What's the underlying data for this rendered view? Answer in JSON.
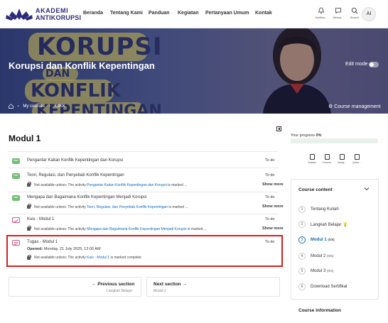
{
  "nav": {
    "logo_line1": "AKADEMI",
    "logo_line2": "ANTIKORUPSI",
    "links": [
      "Beranda",
      "Tentang Kami",
      "Panduan",
      "Kegiatan",
      "Pertanyaan Umum",
      "Kontak"
    ],
    "notifications": "Notifica...",
    "messages": "Messa...",
    "search": "Search",
    "avatar": "AI"
  },
  "hero": {
    "bg_word1": "KORUPSI",
    "bg_word2": "DAN",
    "bg_word3": "KONFLIK",
    "bg_word4": "KEPENTINGAN",
    "title": "Korupsi dan Konflik Kepentingan",
    "edit_mode": "Edit mode",
    "breadcrumb": [
      "My courses",
      "KdKK"
    ],
    "course_management": "Course management"
  },
  "section": {
    "title": "Modul 1",
    "activities": [
      {
        "name": "Pengantar Kaitan Konflik Kepentingan dan Korupsi",
        "status": "To do"
      },
      {
        "name": "Teori, Regulasi, dan Penyebab Konflik Kepentingan",
        "status": "To do",
        "restriction_prefix": "Not available unless: The activity ",
        "restriction_link": "Pengantar Kaitan Konflik Kepentingan dan Korupsi",
        "restriction_suffix": " is marked ... ",
        "more": "Show more"
      },
      {
        "name": "Mengapa dan Bagaimana Konflik Kepentingan Menjadi Korupsi",
        "status": "To do",
        "restriction_prefix": "Not available unless: The activity ",
        "restriction_link": "Teori, Regulasi, dan Penyebab Konflik Kepentingan",
        "restriction_suffix": " is marked ... ",
        "more": "Show more"
      },
      {
        "name": "Kuis - Modul 1",
        "status": "To do",
        "restriction_prefix": "Not available unless: The activity ",
        "restriction_link": "Mengapa dan Bagaimana Konflik Kepentingan Menjadi Korupsi",
        "restriction_suffix": " is marked ... ",
        "more": "Show more"
      },
      {
        "name": "Tugas - Modul 1",
        "status": "To do",
        "opened_label": "Opened:",
        "opened_value": "Monday, 21 July 2025, 12:00 AM",
        "restriction_prefix": "Not available unless: The activity ",
        "restriction_link": "Kuis - Modul 1",
        "restriction_suffix": " is marked complete"
      }
    ],
    "prev_label": "Previous section",
    "prev_sub": "Langkah Belajar",
    "next_label": "Next section",
    "next_sub": "Modul 2"
  },
  "sidebar": {
    "progress_label": "Your progress",
    "progress_value": "0%",
    "progress_fraction": 0.0,
    "tools": [
      "Grades",
      "Forums",
      "Assig...",
      "Quizz..."
    ],
    "course_content_title": "Course content",
    "items": [
      {
        "num": "1",
        "label": "Tentang Kuliah",
        "count": ""
      },
      {
        "num": "2",
        "label": "Langkah Belajar",
        "count": ""
      },
      {
        "num": "3",
        "label": "Modul 1",
        "count": "(0/5)"
      },
      {
        "num": "4",
        "label": "Modul 2",
        "count": "(0/6)"
      },
      {
        "num": "5",
        "label": "Modul 3",
        "count": "(0/4)"
      },
      {
        "num": "6",
        "label": "Download Sertifikat",
        "count": ""
      }
    ],
    "course_info_title": "Course information"
  },
  "colors": {
    "brand": "#2b2c7a",
    "link": "#0f6cbf",
    "highlight": "#d61e1e",
    "pdf_icon": "#6fbf73",
    "quiz_icon": "#d45a7a"
  }
}
